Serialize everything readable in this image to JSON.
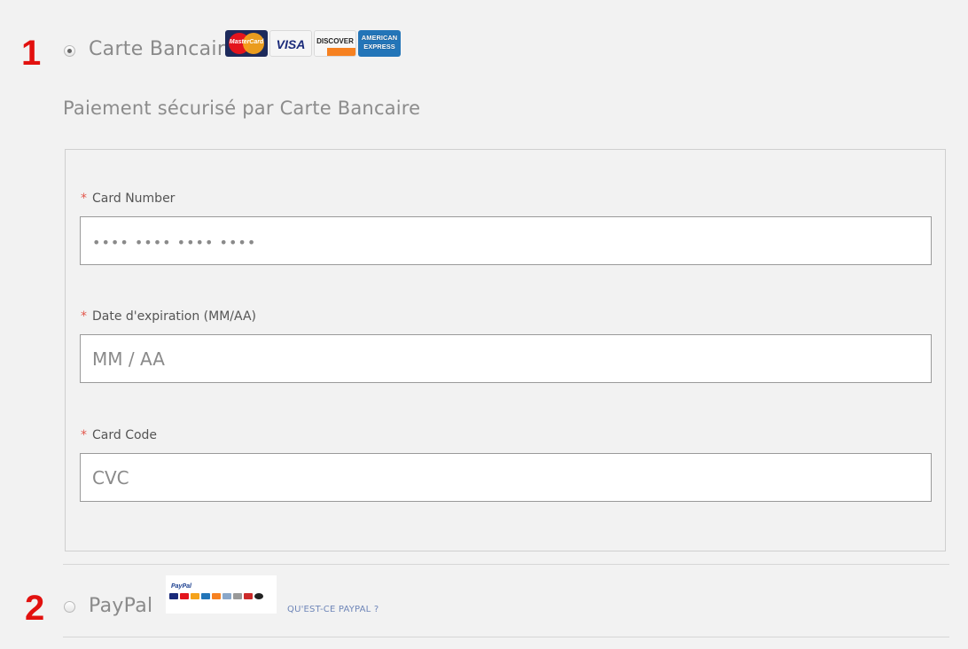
{
  "steps": {
    "first": "1",
    "second": "2"
  },
  "card_method": {
    "label": "Carte Bancaire",
    "selected": true,
    "logos": {
      "mastercard": "MasterCard",
      "visa": "VISA",
      "discover": "DISCOVER",
      "amex_line1": "AMERICAN",
      "amex_line2": "EXPRESS"
    },
    "subtitle": "Paiement sécurisé par Carte Bancaire"
  },
  "form": {
    "required_mark": "*",
    "card_number": {
      "label": "Card Number",
      "placeholder": "•••• •••• •••• ••••"
    },
    "expiry": {
      "label": "Date d'expiration (MM/AA)",
      "placeholder": "MM / AA"
    },
    "cvc": {
      "label": "Card Code",
      "placeholder": "CVC"
    }
  },
  "paypal_method": {
    "label": "PayPal",
    "selected": false,
    "logo_text": "PayPal",
    "link": "QU'EST-CE PAYPAL ?"
  },
  "colors": {
    "step_number": "#e2110f",
    "required": "#e2574c",
    "link": "#6f86b8",
    "background": "#f2f2f2"
  }
}
